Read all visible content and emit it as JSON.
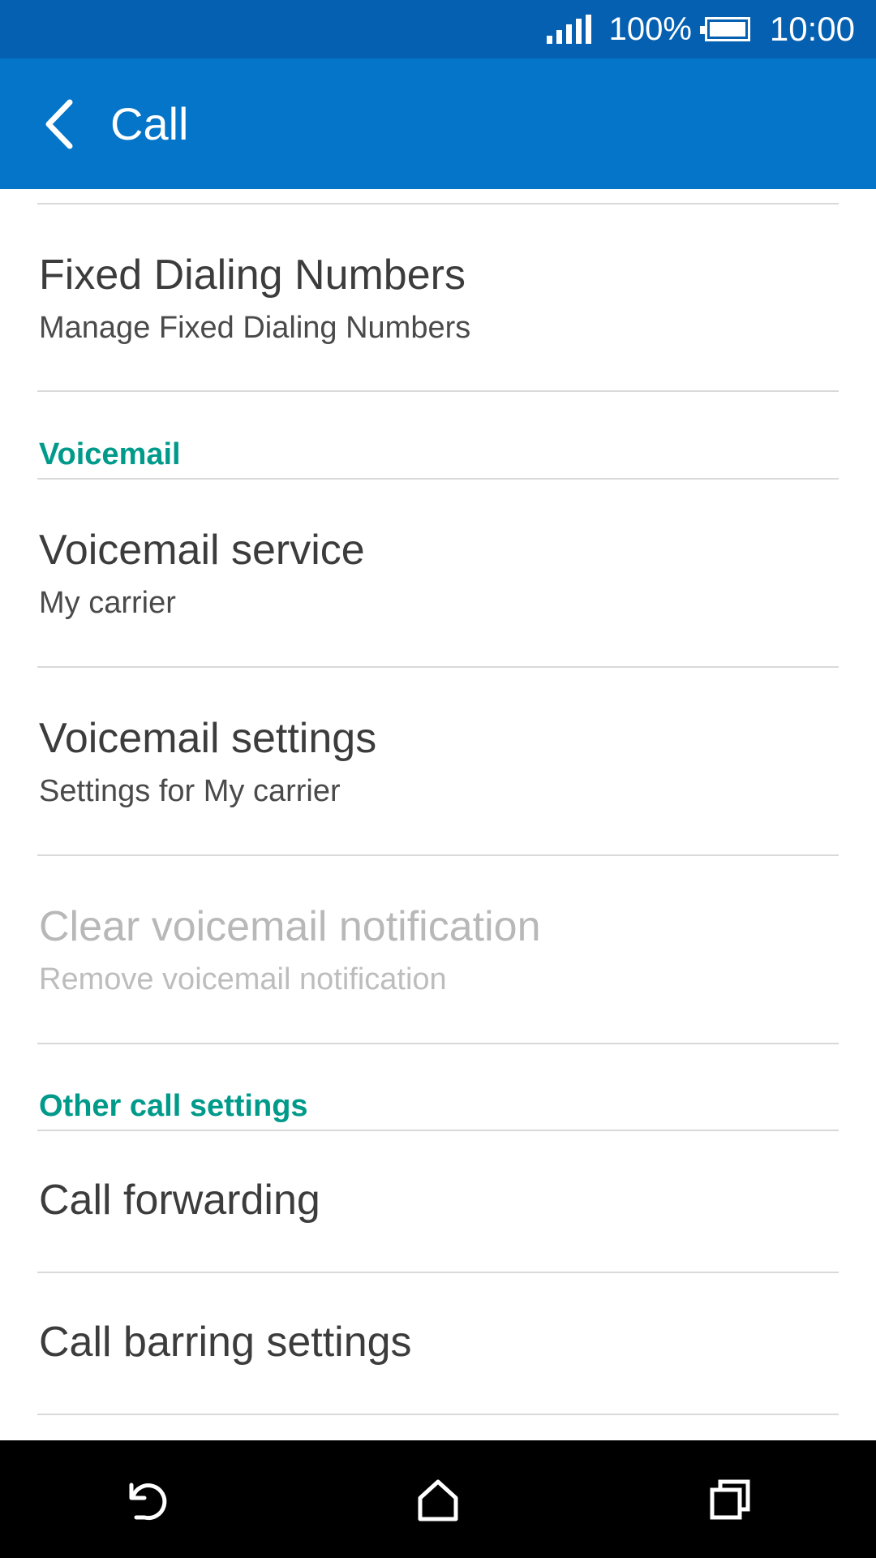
{
  "status_bar": {
    "battery_percent": "100%",
    "time": "10:00",
    "signal_icon": "cellular-signal-icon",
    "battery_icon": "battery-full-icon"
  },
  "app_bar": {
    "title": "Call",
    "back_icon": "chevron-left-icon"
  },
  "list": {
    "fixed_dialing": {
      "title": "Fixed Dialing Numbers",
      "summary": "Manage Fixed Dialing Numbers"
    },
    "voicemail_header": "Voicemail",
    "voicemail_service": {
      "title": "Voicemail service",
      "summary": "My carrier"
    },
    "voicemail_settings": {
      "title": "Voicemail settings",
      "summary": "Settings for My carrier"
    },
    "clear_voicemail": {
      "title": "Clear voicemail notification",
      "summary": "Remove voicemail notification",
      "enabled": false
    },
    "other_header": "Other call settings",
    "call_forwarding": {
      "title": "Call forwarding"
    },
    "call_barring": {
      "title": "Call barring settings"
    }
  },
  "colors": {
    "status_bar": "#0560b1",
    "app_bar": "#0475c8",
    "section_header": "#009a8a",
    "primary_text": "#3c3c3c",
    "disabled_text": "#b8b8b8"
  },
  "nav_bar": {
    "back_icon": "back-arrow-icon",
    "home_icon": "home-icon",
    "recents_icon": "recent-apps-icon"
  }
}
